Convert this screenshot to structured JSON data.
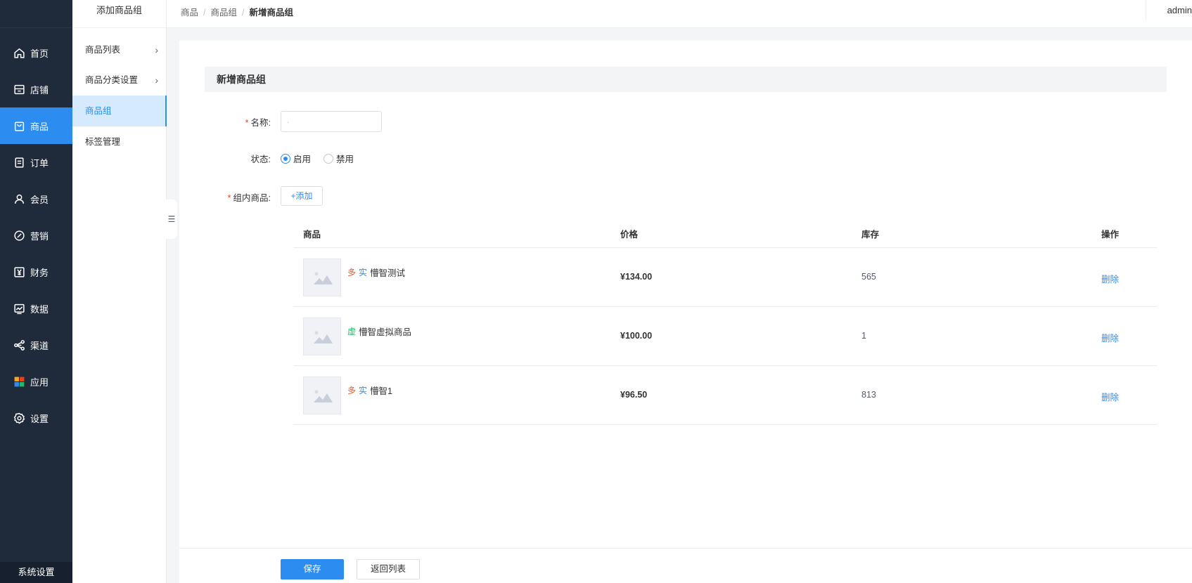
{
  "nav": {
    "items": [
      {
        "label": "首页",
        "icon": "home-icon"
      },
      {
        "label": "店铺",
        "icon": "store-icon"
      },
      {
        "label": "商品",
        "icon": "goods-icon"
      },
      {
        "label": "订单",
        "icon": "order-icon"
      },
      {
        "label": "会员",
        "icon": "user-icon"
      },
      {
        "label": "营销",
        "icon": "marketing-icon"
      },
      {
        "label": "财务",
        "icon": "finance-icon"
      },
      {
        "label": "数据",
        "icon": "data-icon"
      },
      {
        "label": "渠道",
        "icon": "channel-icon"
      },
      {
        "label": "应用",
        "icon": "apps-icon"
      },
      {
        "label": "设置",
        "icon": "settings-icon"
      }
    ],
    "active": "商品",
    "bottom_label": "系统设置",
    "active_color": "#2d8cf0"
  },
  "submenu": {
    "title": "添加商品组",
    "items": [
      {
        "label": "商品列表"
      },
      {
        "label": "商品分类设置"
      },
      {
        "label": "商品组"
      },
      {
        "label": "标签管理"
      }
    ],
    "active": "商品组"
  },
  "header": {
    "breadcrumbs": [
      "商品",
      "商品组",
      "新增商品组"
    ],
    "user": "admin"
  },
  "form": {
    "section_title": "新增商品组",
    "name_label": "名称:",
    "name_value": ".",
    "status_label": "状态:",
    "status_options": [
      "启用",
      "禁用"
    ],
    "status_selected": "启用",
    "goods_label": "组内商品:",
    "add_button": "+添加",
    "table": {
      "columns": [
        "商品",
        "价格",
        "库存",
        "操作"
      ],
      "rows": [
        {
          "tags": [
            "多",
            "实"
          ],
          "name": "懵智测试",
          "price": "¥134.00",
          "stock": "565",
          "action": "删除"
        },
        {
          "tags": [
            "虚"
          ],
          "name": "懵智虚拟商品",
          "price": "¥100.00",
          "stock": "1",
          "action": "删除"
        },
        {
          "tags": [
            "多",
            "实"
          ],
          "name": "懵智1",
          "price": "¥96.50",
          "stock": "813",
          "action": "删除"
        }
      ]
    }
  },
  "footer": {
    "save_label": "保存",
    "back_label": "返回列表"
  }
}
